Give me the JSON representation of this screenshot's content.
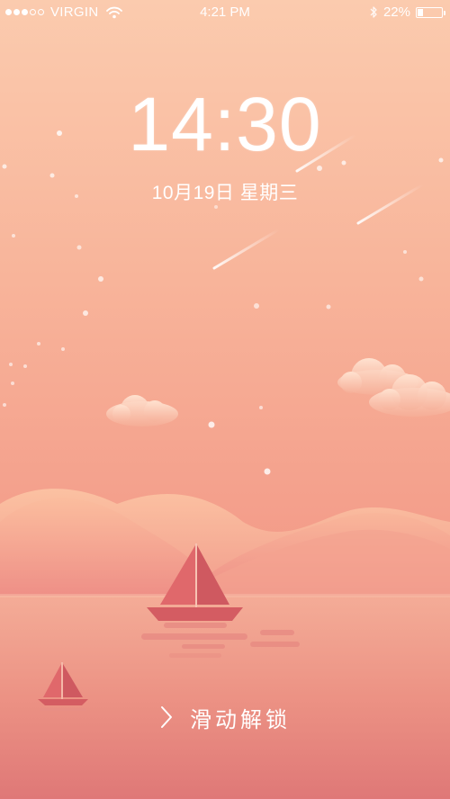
{
  "status_bar": {
    "signal_strength": 3,
    "signal_total": 5,
    "carrier": "VIRGIN",
    "wifi_icon": "wifi-icon",
    "time": "4:21 PM",
    "bluetooth_icon": "bluetooth-icon",
    "battery_text": "22%",
    "battery_level": 0.22
  },
  "lock_screen": {
    "clock": "14:30",
    "date": "10月19日 星期三",
    "unlock_icon": "chevron-right-icon",
    "unlock_label": "滑动解锁"
  },
  "colors": {
    "sky_top": "#fbc9ab",
    "sky_mid": "#f6a991",
    "horizon": "#ee8c84",
    "sea": "#f2a18e",
    "sea_bottom": "#e07d7b",
    "sail": "#d95c63",
    "text": "#ffffff"
  }
}
